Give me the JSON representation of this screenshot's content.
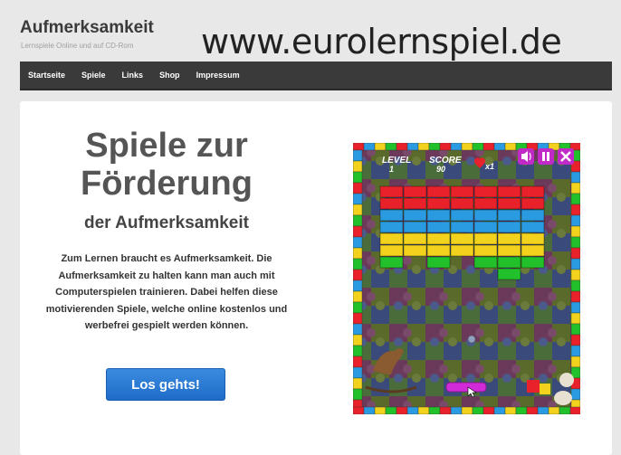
{
  "header": {
    "site_title": "Aufmerksamkeit",
    "site_subtitle": "Lernspiele Online und auf CD-Rom",
    "url_banner": "www.eurolernspiel.de"
  },
  "nav": {
    "items": [
      "Startseite",
      "Spiele",
      "Links",
      "Shop",
      "Impressum"
    ]
  },
  "hero": {
    "title_line1": "Spiele zur",
    "title_line2": "Förderung",
    "subtitle": "der Aufmerksamkeit",
    "text": "Zum Lernen braucht es Aufmerksamkeit. Die Aufmerksamkeit zu halten kann man auch mit Computerspielen trainieren. Dabei helfen diese motivierenden Spiele, welche online kostenlos und werbefrei gespielt werden können.",
    "button_label": "Los gehts!"
  },
  "game_screenshot": {
    "level_label": "LEVEL",
    "level_value": "1",
    "score_label": "SCORE",
    "score_value": "90",
    "lives": "x1",
    "icons": [
      "speaker-icon",
      "pause-icon",
      "close-icon"
    ],
    "brick_colors": [
      "#e8212a",
      "#e8212a",
      "#2a9be0",
      "#2a9be0",
      "#f2d21c",
      "#f2d21c",
      "#22c02a"
    ]
  },
  "colors": {
    "nav_bg": "#3a3a3a",
    "button_bg": "#1e6cc8",
    "page_bg": "#e8e8e8"
  }
}
